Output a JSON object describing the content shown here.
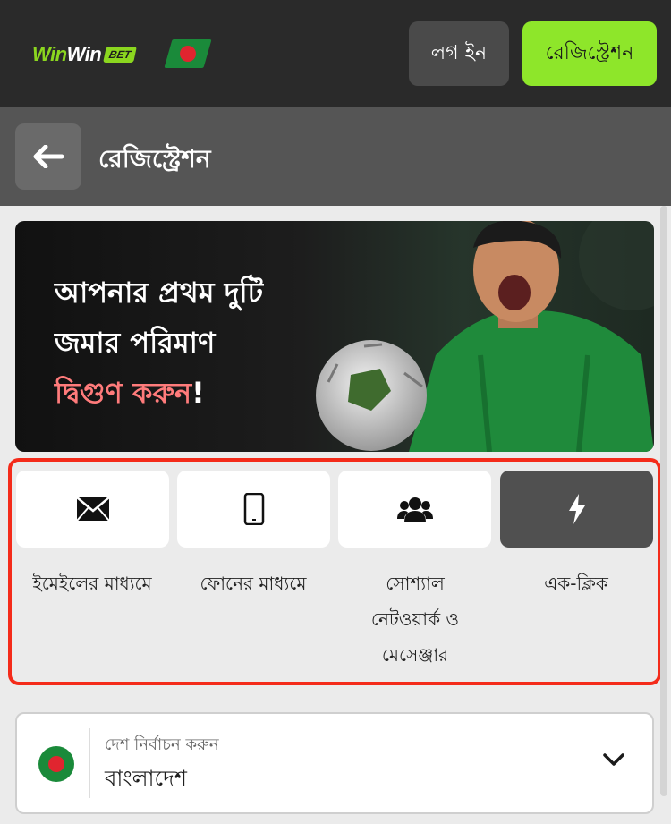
{
  "header": {
    "logo_part1": "Win",
    "logo_part2": "Win",
    "logo_badge": "BET",
    "login_label": "লগ ইন",
    "register_label": "রেজিস্ট্রেশন"
  },
  "subheader": {
    "title": "রেজিস্ট্রেশন",
    "back_icon": "arrow-left-icon"
  },
  "banner": {
    "line1": "আপনার প্রথম দুটি",
    "line2": "জমার পরিমাণ",
    "line3_highlight": "দ্বিগুণ করুন",
    "line3_suffix": "!"
  },
  "registration_methods": [
    {
      "label": "ইমেইলের মাধ্যমে",
      "icon": "envelope-icon",
      "active": false
    },
    {
      "label": "ফোনের মাধ্যমে",
      "icon": "phone-icon",
      "active": false
    },
    {
      "label_line1": "সোশ্যাল",
      "label_line2": "নেটওয়ার্ক ও",
      "label_line3": "মেসেঞ্জার",
      "icon": "users-icon",
      "active": false
    },
    {
      "label": "এক-ক্লিক",
      "icon": "lightning-icon",
      "active": true
    }
  ],
  "country_select": {
    "caption": "দেশ নির্বাচন করুন",
    "value": "বাংলাদেশ",
    "icon": "chevron-down-icon"
  },
  "colors": {
    "accent": "#8ee62a",
    "highlight_border": "#f42b1a",
    "header_bg": "#2a2a2a",
    "subheader_bg": "#555555"
  }
}
